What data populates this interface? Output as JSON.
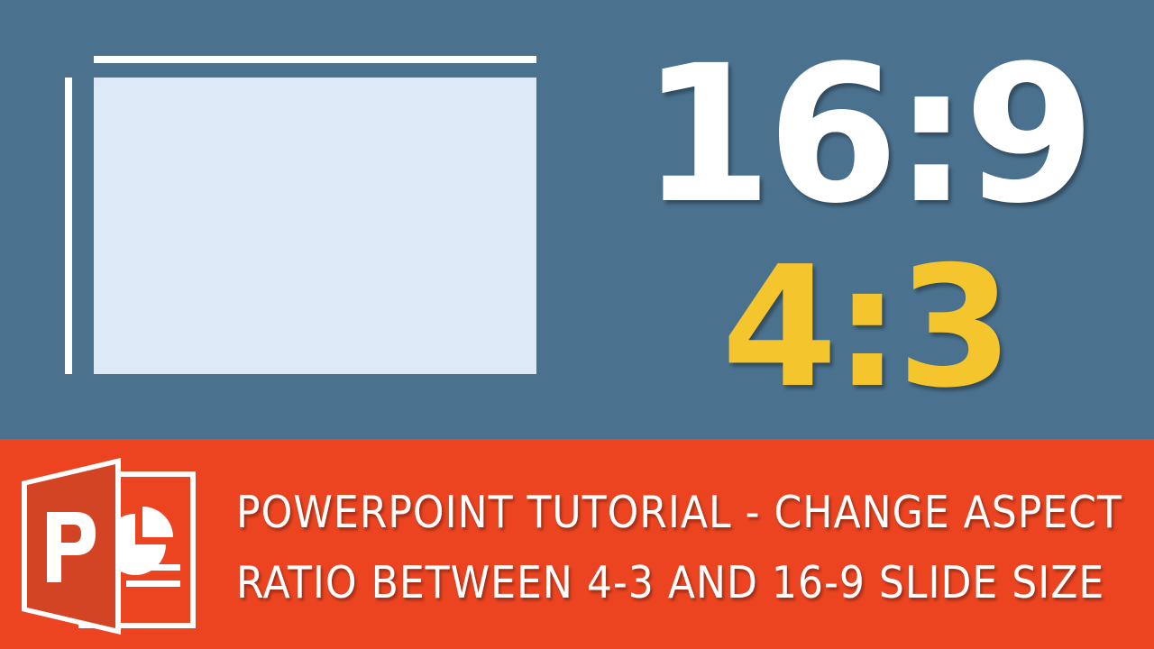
{
  "ratios": {
    "primary": "16:9",
    "secondary": "4:3"
  },
  "banner": {
    "line1": "POWERPOINT TUTORIAL - CHANGE ASPECT",
    "line2": "RATIO BETWEEN 4-3 AND 16-9 SLIDE SIZE",
    "logo_letter": "P",
    "logo_icon": "powerpoint-logo-icon"
  },
  "colors": {
    "background": "#4a728f",
    "slide": "#dde9f6",
    "accent_yellow": "#f5c52e",
    "banner": "#ec4420",
    "logo_dark": "#c43e1c"
  }
}
